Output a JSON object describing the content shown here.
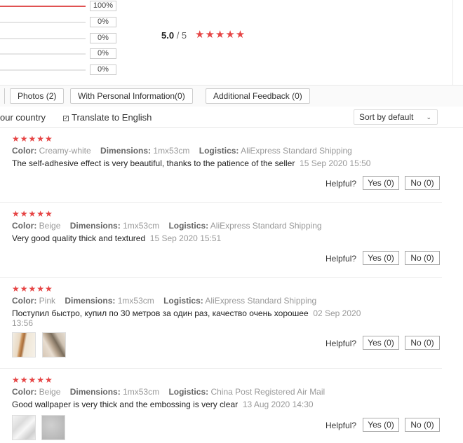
{
  "summary": {
    "rows": [
      {
        "pct": "100%",
        "fill": 1.0
      },
      {
        "pct": "0%",
        "fill": 0
      },
      {
        "pct": "0%",
        "fill": 0
      },
      {
        "pct": "0%",
        "fill": 0
      },
      {
        "pct": "0%",
        "fill": 0
      }
    ],
    "score": "5.0",
    "out_of": "/ 5",
    "stars": "★★★★★"
  },
  "filters": {
    "photos": "Photos (2)",
    "personal": "With Personal Information(0)",
    "additional": "Additional Feedback (0)"
  },
  "options": {
    "country": "our country",
    "translate_check": "✓",
    "translate": "Translate to English",
    "sort": "Sort by default",
    "sort_caret": "⌄"
  },
  "labels": {
    "color": "Color:",
    "dimensions": "Dimensions:",
    "logistics": "Logistics:",
    "helpful": "Helpful?"
  },
  "reviews": [
    {
      "stars": "★★★★★",
      "color": "Creamy-white",
      "dimensions": "1mx53cm",
      "logistics": "AliExpress Standard Shipping",
      "text": "The self-adhesive effect is very beautiful, thanks to the patience of the seller",
      "date": "15 Sep 2020 15:50",
      "yes": "Yes (0)",
      "no": "No (0)"
    },
    {
      "stars": "★★★★★",
      "color": "Beige",
      "dimensions": "1mx53cm",
      "logistics": "AliExpress Standard Shipping",
      "text": "Very good quality thick and textured",
      "date": "15 Sep 2020 15:51",
      "yes": "Yes (0)",
      "no": "No (0)"
    },
    {
      "stars": "★★★★★",
      "color": "Pink",
      "dimensions": "1mx53cm",
      "logistics": "AliExpress Standard Shipping",
      "text": "Поступил быстро, купил по 30 метров за один раз, качество очень хорошее",
      "date": "02 Sep 2020 13:56",
      "yes": "Yes (0)",
      "no": "No (0)"
    },
    {
      "stars": "★★★★★",
      "color": "Beige",
      "dimensions": "1mx53cm",
      "logistics": "China Post Registered Air Mail",
      "text": "Good wallpaper is very thick and the embossing is very clear",
      "date": "13 Aug 2020 14:30",
      "yes": "Yes (0)",
      "no": "No (0)"
    }
  ],
  "colors": {
    "star": "#e64545",
    "bar_fill": "#e05252"
  }
}
